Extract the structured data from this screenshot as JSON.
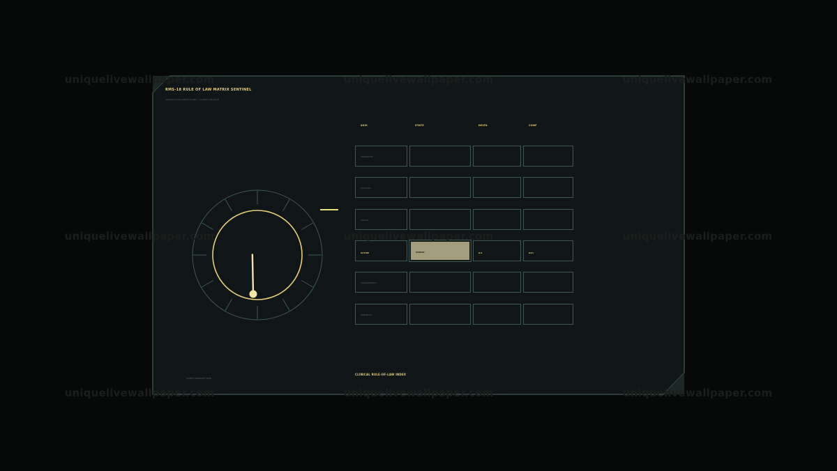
{
  "watermark": "uniquelivewallpaper.com",
  "panel": {
    "title": "RMS-18  RULE OF LAW MATRIX SENTINEL",
    "subtitle": "JURISDICTION MONITORING / ALERTS ENGAGE",
    "footer_left": "MATRIX SUMMARY  VIEW",
    "footer_center": "CLINICAL RULE-OF-LAW INDEX"
  },
  "table": {
    "headers": [
      "AXIS",
      "STATE",
      "DELTA",
      "CONF"
    ],
    "rows": [
      {
        "label": "OVERSIGHT",
        "state": "",
        "delta": "",
        "conf": ""
      },
      {
        "label": "JUDICIARY",
        "state": "",
        "delta": "",
        "conf": ""
      },
      {
        "label": "RIGHTS",
        "state": "",
        "delta": "",
        "conf": ""
      },
      {
        "label": "ACTIVE",
        "state": "STABLE",
        "delta": "0.8",
        "conf": "91%"
      },
      {
        "label": "TRANSPARENCY",
        "state": "",
        "delta": "",
        "conf": ""
      },
      {
        "label": "FEEDBACK",
        "state": "",
        "delta": "",
        "conf": ""
      }
    ],
    "active_row_index": 3
  },
  "gauge": {
    "level": 0.52,
    "needle_icon": "needle-icon"
  },
  "colors": {
    "background": "#070908",
    "panel": "#101617",
    "border": "#4b6a66",
    "accent": "#e8cf7a",
    "highlight": "#a39c7d"
  }
}
